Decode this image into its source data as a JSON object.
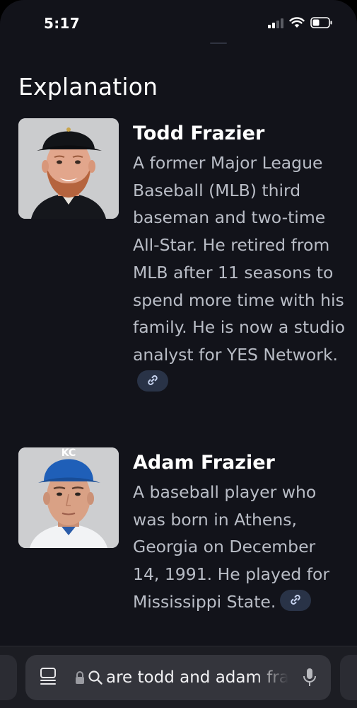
{
  "status_bar": {
    "time": "5:17"
  },
  "section": {
    "title": "Explanation"
  },
  "entries": [
    {
      "name": "Todd Frazier",
      "description": "A former Major League Baseball (MLB) third baseman and two-time All-Star. He retired from MLB after 11 seasons to spend more time with his family. He is now a studio analyst for YES Network.",
      "link_icon": "link-icon"
    },
    {
      "name": "Adam Frazier",
      "description": "A baseball player who was born in Athens, Georgia on December 14, 1991. He played for Mississippi State.",
      "link_icon": "link-icon"
    }
  ],
  "address_bar": {
    "query": "are todd and adam fra",
    "icons": [
      "tabs-icon",
      "lock-icon",
      "search-icon",
      "mic-icon"
    ]
  },
  "colors": {
    "background": "#12131a",
    "description_text": "#b9bdc6",
    "link_chip": "#293347",
    "address_pill": "#34353c"
  }
}
